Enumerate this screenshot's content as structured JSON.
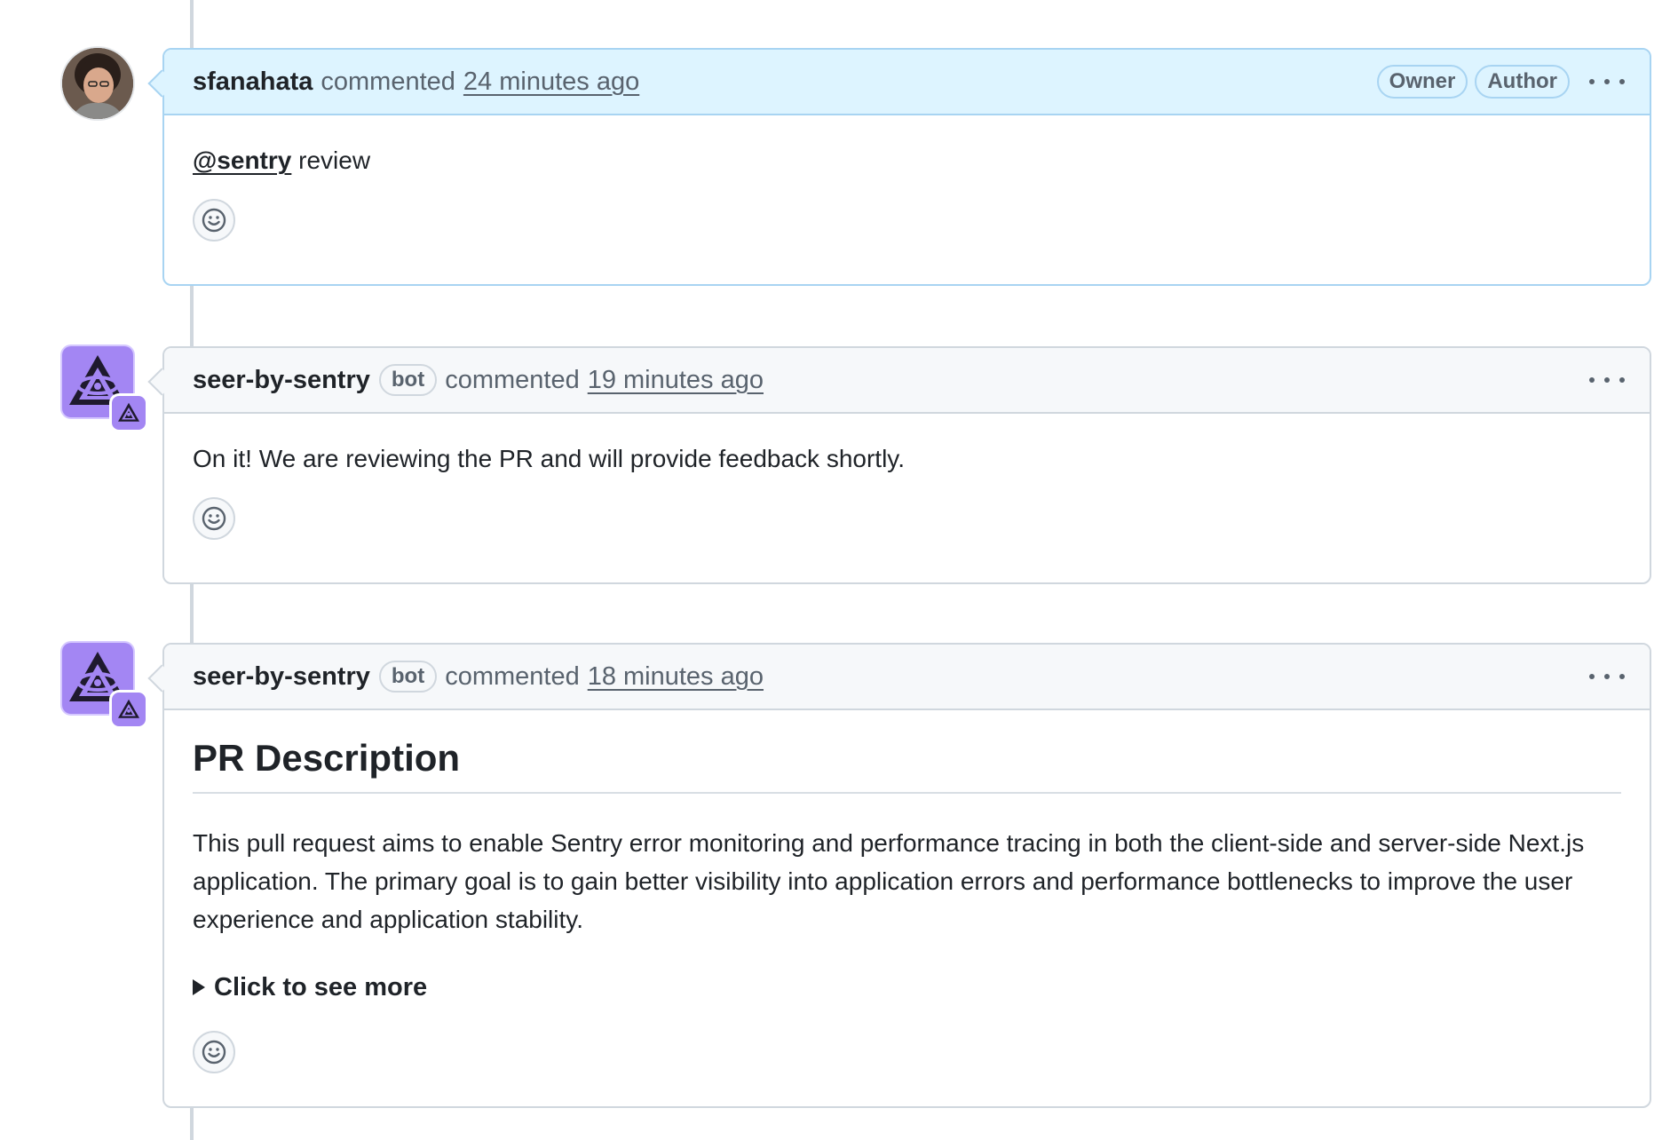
{
  "comments": [
    {
      "author": "sfanahata",
      "action": "commented",
      "time": "24 minutes ago",
      "badges": [
        "Owner",
        "Author"
      ],
      "mention": "@sentry",
      "body_text": " review"
    },
    {
      "author": "seer-by-sentry",
      "bot_label": "bot",
      "action": "commented",
      "time": "19 minutes ago",
      "body_text": "On it! We are reviewing the PR and will provide feedback shortly."
    },
    {
      "author": "seer-by-sentry",
      "bot_label": "bot",
      "action": "commented",
      "time": "18 minutes ago",
      "heading": "PR Description",
      "paragraph": "This pull request aims to enable Sentry error monitoring and performance tracing in both the client-side and server-side Next.js application. The primary goal is to gain better visibility into application errors and performance bottlenecks to improve the user experience and application stability.",
      "details_summary": "Click to see more"
    }
  ],
  "icons": {
    "more": "kebab-horizontal-icon",
    "reaction": "smiley-icon",
    "bot_avatar": "seer-eye-triangle-icon"
  },
  "colors": {
    "owner_header_bg": "#ddf4ff",
    "owner_border": "#a8d4f2",
    "header_bg": "#f6f8fa",
    "border": "#d0d7de",
    "bot_avatar_bg": "#a386f3"
  }
}
